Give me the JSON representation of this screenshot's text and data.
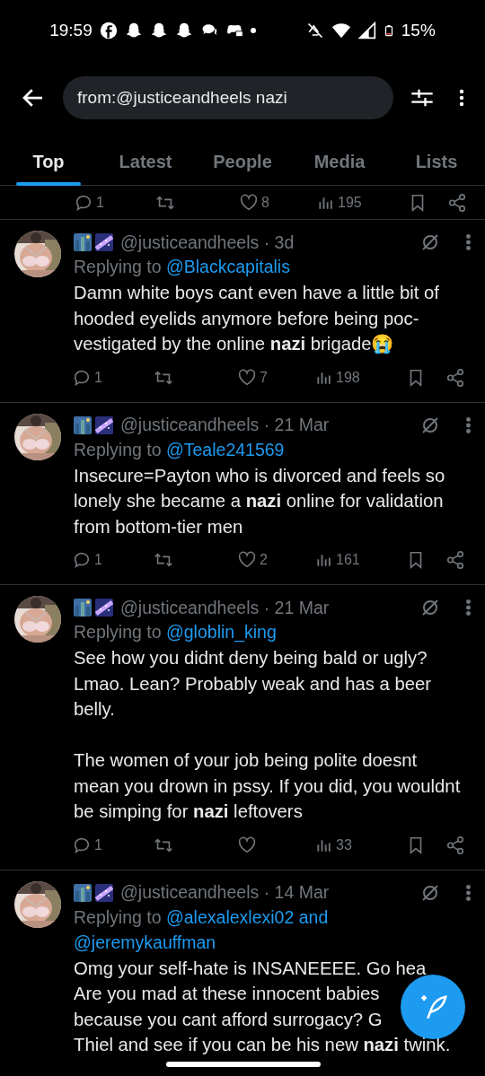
{
  "status_bar": {
    "time": "19:59",
    "battery": "15%"
  },
  "search": {
    "value": "from:@justiceandheels nazi"
  },
  "tabs": [
    {
      "label": "Top",
      "selected": true
    },
    {
      "label": "Latest",
      "selected": false
    },
    {
      "label": "People",
      "selected": false
    },
    {
      "label": "Media",
      "selected": false
    },
    {
      "label": "Lists",
      "selected": false
    }
  ],
  "previous_tweet_actions": {
    "replies": "1",
    "likes": "8",
    "views": "195"
  },
  "tweets": [
    {
      "meta": "@justiceandheels · 3d",
      "replying_prefix": "Replying to",
      "mentions": [
        "@Blackcapitalis"
      ],
      "text": "Damn white boys cant even have a little bit of hooded eyelids anymore before being poc-vestigated by the online **nazi** brigade😭",
      "actions": {
        "replies": "1",
        "likes": "7",
        "views": "198"
      }
    },
    {
      "meta": "@justiceandheels · 21 Mar",
      "replying_prefix": "Replying to",
      "mentions": [
        "@Teale241569"
      ],
      "text": "Insecure=Payton who is divorced and feels so lonely she became a **nazi** online for validation from bottom-tier men",
      "actions": {
        "replies": "1",
        "likes": "2",
        "views": "161"
      }
    },
    {
      "meta": "@justiceandheels · 21 Mar",
      "replying_prefix": "Replying to",
      "mentions": [
        "@globlin_king"
      ],
      "text": "See how you didnt deny being bald or ugly? Lmao. Lean? Probably weak and has a beer belly.\n\nThe women of your job being polite doesnt mean you drown in pssy. If you did, you wouldnt be simping for **nazi** leftovers",
      "actions": {
        "replies": "1",
        "views": "33"
      }
    },
    {
      "meta": "@justiceandheels · 14 Mar",
      "replying_prefix": "Replying to",
      "mentions": [
        "@alexalexlexi02 and",
        "@jeremykauffman"
      ],
      "lines": [
        "Omg your self-hate is INSANEEEE. Go hea",
        "Are you mad at these innocent babies",
        "because you cant afford surrogacy? G",
        "Thiel and see if you can be his new **nazi** twink."
      ]
    }
  ]
}
